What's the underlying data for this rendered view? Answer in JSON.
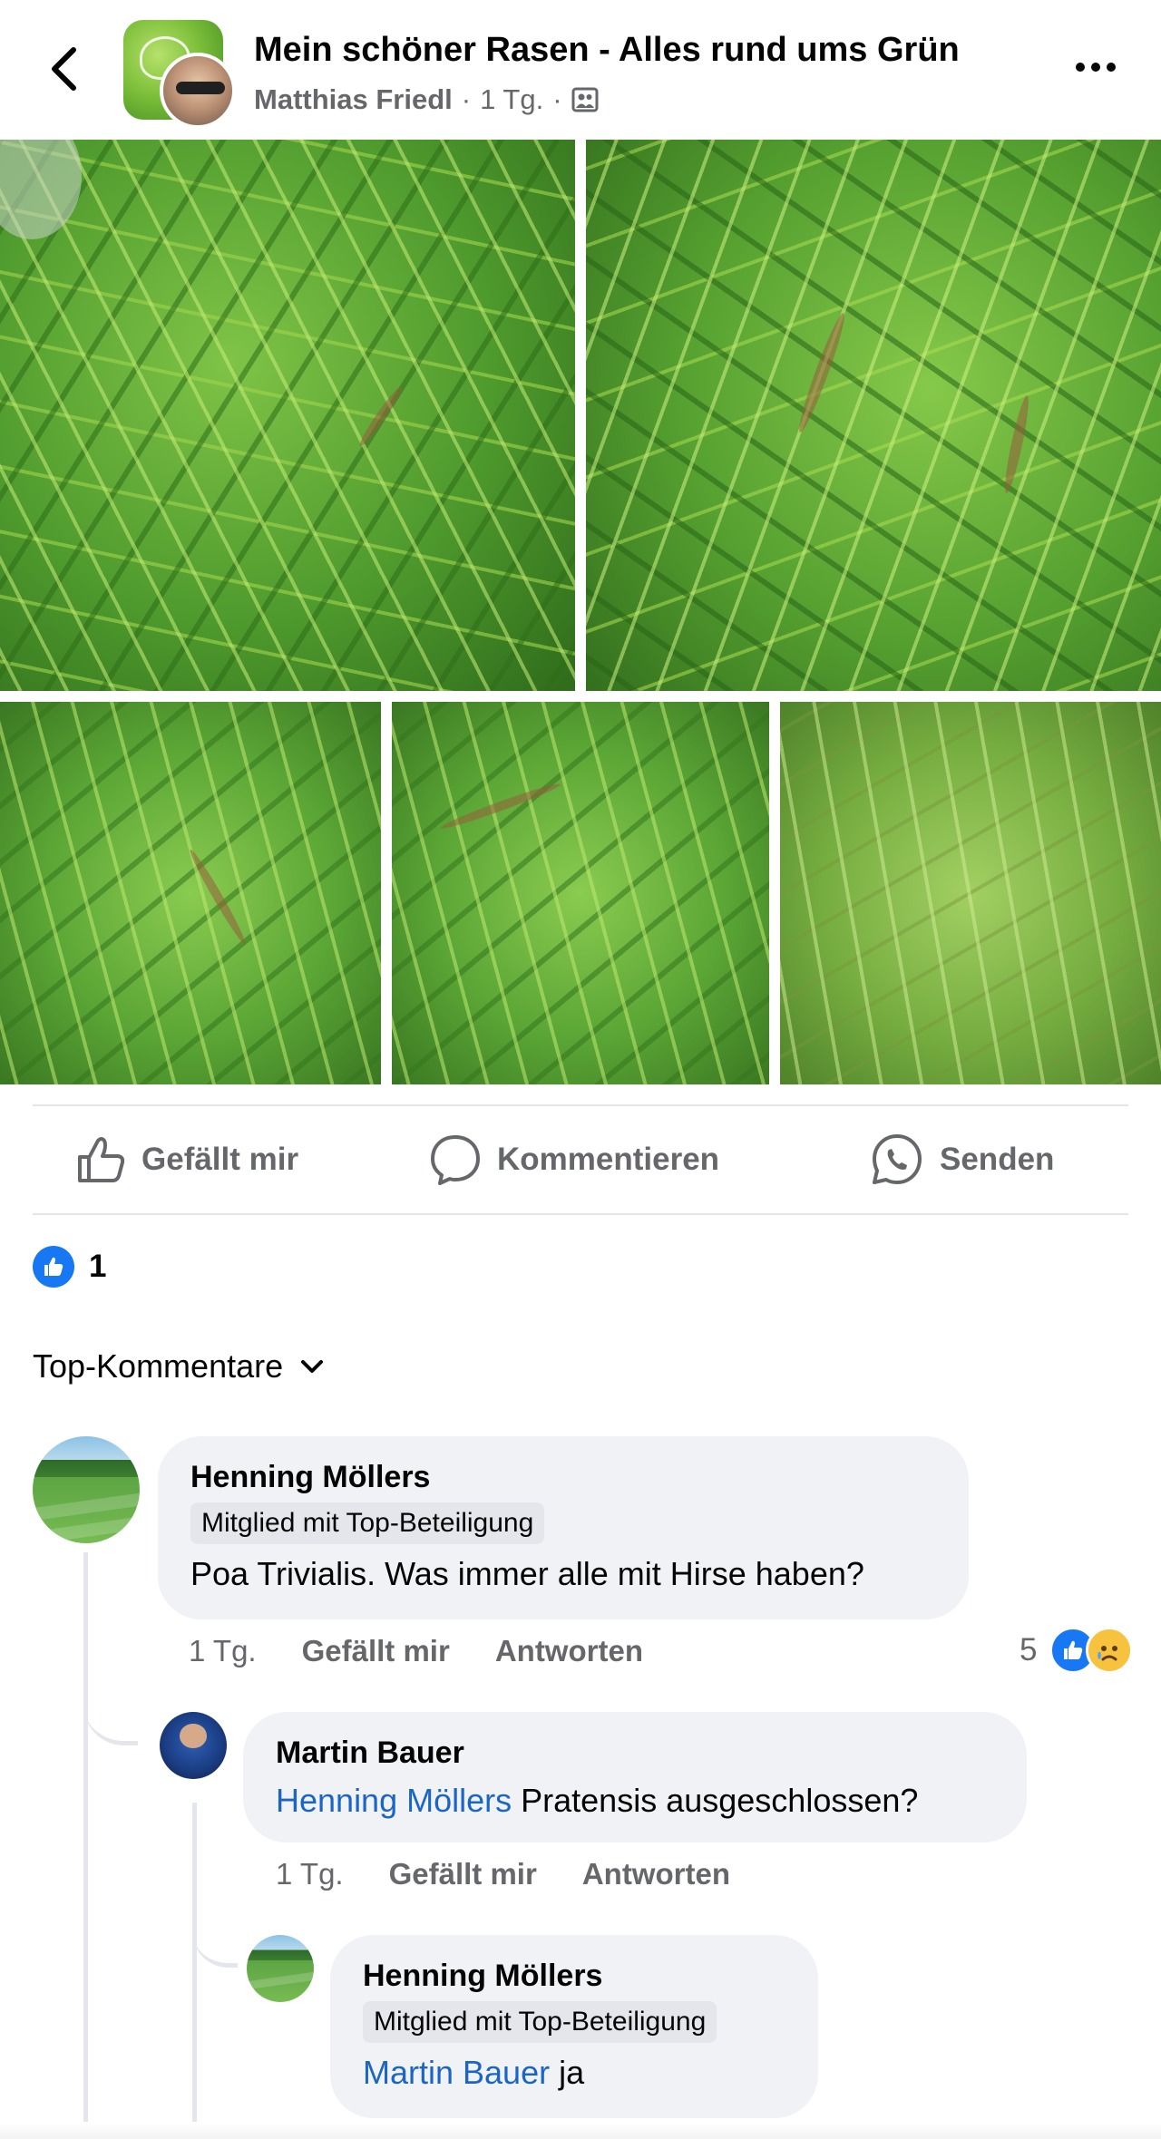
{
  "header": {
    "title": "Mein schöner Rasen - Alles rund ums Grün",
    "author": "Matthias Friedl",
    "separator": "·",
    "time": "1 Tg.",
    "audience_icon": "group-members-icon"
  },
  "photos": [
    {
      "alt": "grass-photo-1"
    },
    {
      "alt": "grass-photo-2"
    },
    {
      "alt": "grass-photo-3"
    },
    {
      "alt": "grass-photo-4"
    },
    {
      "alt": "grass-photo-5"
    }
  ],
  "actions": {
    "like": "Gefällt mir",
    "comment": "Kommentieren",
    "send": "Senden"
  },
  "reactions": {
    "count": "1"
  },
  "comments_filter": {
    "label": "Top-Kommentare"
  },
  "comments": [
    {
      "name": "Henning Möllers",
      "badge": "Mitglied mit Top-Beteiligung",
      "text": "Poa Trivialis. Was immer alle mit Hirse haben?",
      "time": "1 Tg.",
      "like": "Gefällt mir",
      "reply": "Antworten",
      "reaction_count": "5"
    },
    {
      "name": "Martin Bauer",
      "mention": "Henning Möllers",
      "text": "Pratensis ausgeschlossen?",
      "time": "1 Tg.",
      "like": "Gefällt mir",
      "reply": "Antworten"
    },
    {
      "name": "Henning Möllers",
      "badge": "Mitglied mit Top-Beteiligung",
      "mention": "Martin Bauer",
      "text": "ja"
    }
  ],
  "colors": {
    "primary_text": "#050505",
    "secondary_text": "#65676b",
    "bubble": "#f0f2f5",
    "link": "#1a66c2",
    "like_blue": "#1877f2"
  }
}
